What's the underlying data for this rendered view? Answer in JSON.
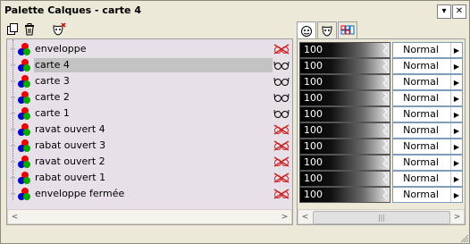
{
  "window": {
    "title": "Palette Calques - carte 4",
    "minimize_glyph": "▾",
    "close_glyph": "✕"
  },
  "toolbar": {
    "icons": [
      "new-layer-icon",
      "delete-layer-icon",
      "mask-icon"
    ]
  },
  "tabs": [
    {
      "name": "tab-layer-settings",
      "icon": "mask-face-icon",
      "active": true
    },
    {
      "name": "tab-mask",
      "icon": "mask-icon",
      "active": false
    },
    {
      "name": "tab-channels",
      "icon": "channels-icon",
      "active": false
    }
  ],
  "layers": [
    {
      "name": "enveloppe",
      "visible": false,
      "selected": false,
      "opacity": "100",
      "blend": "Normal"
    },
    {
      "name": "carte 4",
      "visible": true,
      "selected": true,
      "opacity": "100",
      "blend": "Normal"
    },
    {
      "name": "carte 3",
      "visible": true,
      "selected": false,
      "opacity": "100",
      "blend": "Normal"
    },
    {
      "name": "carte 2",
      "visible": true,
      "selected": false,
      "opacity": "100",
      "blend": "Normal"
    },
    {
      "name": "carte 1",
      "visible": true,
      "selected": false,
      "opacity": "100",
      "blend": "Normal"
    },
    {
      "name": "ravat ouvert 4",
      "visible": false,
      "selected": false,
      "opacity": "100",
      "blend": "Normal"
    },
    {
      "name": "rabat ouvert 3",
      "visible": false,
      "selected": false,
      "opacity": "100",
      "blend": "Normal"
    },
    {
      "name": "ravat ouvert 2",
      "visible": false,
      "selected": false,
      "opacity": "100",
      "blend": "Normal"
    },
    {
      "name": "rabat ouvert 1",
      "visible": false,
      "selected": false,
      "opacity": "100",
      "blend": "Normal"
    },
    {
      "name": "enveloppe fermée",
      "visible": false,
      "selected": false,
      "opacity": "100",
      "blend": "Normal"
    }
  ],
  "scroll": {
    "left_arrow": "<",
    "right_arrow": ">",
    "thumb_grip": "|||"
  },
  "colors": {
    "list_background": "#e7e0e8",
    "selected_row": "#c3c3c3",
    "hidden_red": "#cc2222"
  }
}
